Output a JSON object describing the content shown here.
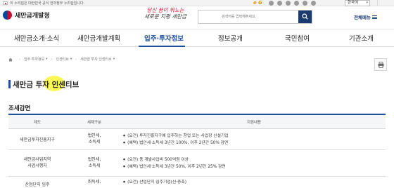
{
  "gov_banner": {
    "notice": "이 누리집은 대한민국 공식 전자정부 누리집입니다.",
    "egov_label": "e G",
    "language": "한국어"
  },
  "header": {
    "logo_text": "새만금개발청",
    "slogan_line1": "당신 꿈이 뛰노는",
    "slogan_line2": "새로운 지평 새만금",
    "search_placeholder": "검색어를 입력해주세요.",
    "sitemap_label": "전체메뉴"
  },
  "gnb": [
    {
      "label": "새만금소개·소식"
    },
    {
      "label": "새만금개발계획"
    },
    {
      "label": "입주·투자정보"
    },
    {
      "label": "정보공개"
    },
    {
      "label": "국민참여"
    },
    {
      "label": "기관소개"
    }
  ],
  "breadcrumb": [
    "입주·투자정보",
    "인센티브",
    "새만금 투자 인센티브"
  ],
  "page": {
    "title": "새만금 투자 인센티브",
    "section_title": "조세감면"
  },
  "table": {
    "headers": [
      "제도",
      "세제구분",
      "지원내용"
    ],
    "rows": [
      {
        "system": "새만금투자진흥지구",
        "tax_type": "법인세,\n소득세",
        "content": [
          "(요건) 투자진흥지구에 입주하는 창업 또는 사업장 신설기업",
          "(혜택) 법인세·소득세 3년간 100%, 이후 2년간 50% 감면"
        ]
      },
      {
        "system": "새만금사업지역\n사업시행자",
        "tax_type": "법인세,\n소득세",
        "content": [
          "(요건) 총 개발사업비 500억원 이상",
          "(혜택) 법인세·소득세 3년간 50%, 이후 2년간 25% 감면"
        ]
      },
      {
        "system": "산업단지 입주",
        "tax_type": "취득세,",
        "content": [
          "(요건) 산업단지 입주기업(신·증축)"
        ]
      }
    ]
  },
  "colors": {
    "accent": "#1f4e9c",
    "search_button": "#1b3a6e",
    "highlight": "#faf519"
  }
}
